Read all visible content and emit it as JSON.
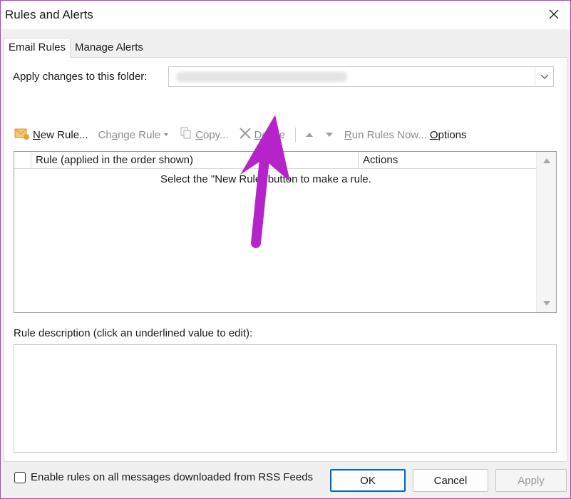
{
  "window": {
    "title": "Rules and Alerts"
  },
  "tabs": [
    {
      "label": "Email Rules",
      "active": true
    },
    {
      "label": "Manage Alerts",
      "active": false
    }
  ],
  "folder": {
    "label": "Apply changes to this folder:",
    "value_obscured": true
  },
  "toolbar": {
    "new_rule": {
      "prefix": "N",
      "rest": "ew Rule...",
      "icon": "new-rule-icon",
      "enabled": true
    },
    "change_rule": {
      "prefix": "Ch",
      "underlined": "a",
      "rest": "nge Rule",
      "icon": "dropdown-caret-icon",
      "enabled": false
    },
    "copy": {
      "prefix": "",
      "underlined": "C",
      "rest": "opy...",
      "icon": "copy-icon",
      "enabled": false
    },
    "delete": {
      "prefix": "",
      "underlined": "D",
      "rest": "elete",
      "icon": "x-icon",
      "enabled": false
    },
    "move_up": {
      "icon": "triangle-up-icon",
      "enabled": false
    },
    "move_down": {
      "icon": "triangle-down-icon",
      "enabled": false
    },
    "run_rules": {
      "prefix": "",
      "underlined": "R",
      "rest": "un Rules Now...",
      "enabled": false
    },
    "options": {
      "prefix": "",
      "underlined": "O",
      "rest": "ptions",
      "enabled": true
    }
  },
  "rules_table": {
    "columns": [
      "Rule (applied in the order shown)",
      "Actions"
    ],
    "rows": [],
    "empty_message": "Select the \"New Rule\" button to make a rule."
  },
  "description": {
    "label": "Rule description (click an underlined value to edit):"
  },
  "rss": {
    "label": "Enable rules on all messages downloaded from RSS Feeds",
    "checked": false
  },
  "buttons": {
    "ok": "OK",
    "cancel": "Cancel",
    "apply": "Apply"
  },
  "colors": {
    "annotation_arrow": "#b424c8",
    "ok_border": "#0067c0",
    "disabled_text": "#8c8c8c"
  }
}
